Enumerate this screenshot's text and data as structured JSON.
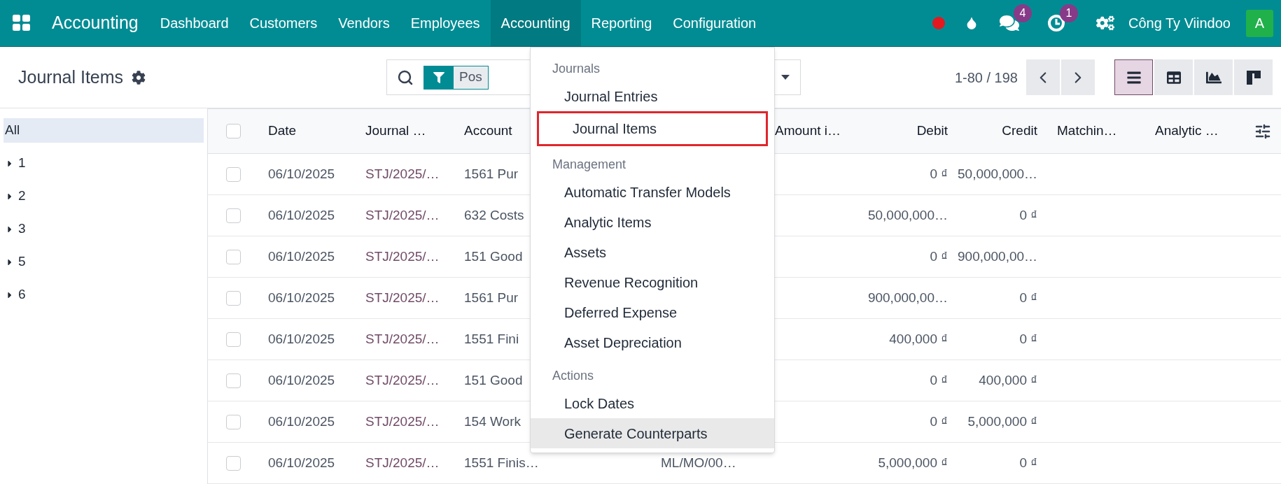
{
  "navbar": {
    "brand": "Accounting",
    "menus": [
      {
        "label": "Dashboard",
        "selected": false
      },
      {
        "label": "Customers",
        "selected": false
      },
      {
        "label": "Vendors",
        "selected": false
      },
      {
        "label": "Employees",
        "selected": false
      },
      {
        "label": "Accounting",
        "selected": true
      },
      {
        "label": "Reporting",
        "selected": false
      },
      {
        "label": "Configuration",
        "selected": false
      }
    ],
    "messages_badge": "4",
    "activities_badge": "1",
    "company": "Công Ty Viindoo",
    "avatar": "A"
  },
  "control_panel": {
    "title": "Journal Items",
    "search_facet": "Pos",
    "pager": "1-80 / 198",
    "views": [
      {
        "kind": "list",
        "selected": true
      },
      {
        "kind": "pivot",
        "selected": false
      },
      {
        "kind": "graph",
        "selected": false
      },
      {
        "kind": "kanban",
        "selected": false
      }
    ]
  },
  "sidebar": {
    "items": [
      {
        "label": "All",
        "kind": "all",
        "selected": true
      },
      {
        "label": "1",
        "kind": "group",
        "selected": false
      },
      {
        "label": "2",
        "kind": "group",
        "selected": false
      },
      {
        "label": "3",
        "kind": "group",
        "selected": false
      },
      {
        "label": "5",
        "kind": "group",
        "selected": false
      },
      {
        "label": "6",
        "kind": "group",
        "selected": false
      }
    ]
  },
  "table": {
    "columns": [
      {
        "label": "Date"
      },
      {
        "label": "Journal …"
      },
      {
        "label": "Account"
      },
      {
        "label": "Amount i…"
      },
      {
        "label": "Debit"
      },
      {
        "label": "Credit"
      },
      {
        "label": "Matchin…"
      },
      {
        "label": "Analytic …"
      }
    ],
    "header_checked": false,
    "rows": [
      {
        "checked": false,
        "date": "06/10/2025",
        "journal": "STJ/2025/…",
        "account": "1561 Pur",
        "debit": "0 ₫",
        "credit": "50,000,000…"
      },
      {
        "checked": false,
        "date": "06/10/2025",
        "journal": "STJ/2025/…",
        "account": "632 Costs",
        "debit": "50,000,000…",
        "credit": "0 ₫"
      },
      {
        "checked": false,
        "date": "06/10/2025",
        "journal": "STJ/2025/…",
        "account": "151 Good",
        "debit": "0 ₫",
        "credit": "900,000,00…"
      },
      {
        "checked": false,
        "date": "06/10/2025",
        "journal": "STJ/2025/…",
        "account": "1561 Pur",
        "debit": "900,000,00…",
        "credit": "0 ₫"
      },
      {
        "checked": false,
        "date": "06/10/2025",
        "journal": "STJ/2025/…",
        "account": "1551 Fini",
        "debit": "400,000 ₫",
        "credit": "0 ₫"
      },
      {
        "checked": false,
        "date": "06/10/2025",
        "journal": "STJ/2025/…",
        "account": "151 Good",
        "debit": "0 ₫",
        "credit": "400,000 ₫"
      },
      {
        "checked": false,
        "date": "06/10/2025",
        "journal": "STJ/2025/…",
        "account": "154 Work",
        "debit": "0 ₫",
        "credit": "5,000,000 ₫"
      },
      {
        "checked": false,
        "date": "06/10/2025",
        "journal": "STJ/2025/…",
        "account": "1551 Finis…",
        "column_5": "ML/MO/00…",
        "debit": "5,000,000 ₫",
        "credit": "0 ₫"
      }
    ]
  },
  "dropdown_menu": {
    "sections": [
      {
        "heading": "Journals",
        "items": [
          {
            "label": "Journal Entries",
            "highlighted": false,
            "outlined": false
          },
          {
            "label": "Journal Items",
            "highlighted": false,
            "outlined": true
          }
        ]
      },
      {
        "heading": "Management",
        "items": [
          {
            "label": "Automatic Transfer Models",
            "highlighted": false,
            "outlined": false
          },
          {
            "label": "Analytic Items",
            "highlighted": false,
            "outlined": false
          },
          {
            "label": "Assets",
            "highlighted": false,
            "outlined": false
          },
          {
            "label": "Revenue Recognition",
            "highlighted": false,
            "outlined": false
          },
          {
            "label": "Deferred Expense",
            "highlighted": false,
            "outlined": false
          },
          {
            "label": "Asset Depreciation",
            "highlighted": false,
            "outlined": false
          }
        ]
      },
      {
        "heading": "Actions",
        "items": [
          {
            "label": "Lock Dates",
            "highlighted": false,
            "outlined": false
          },
          {
            "label": "Generate Counterparts",
            "highlighted": true,
            "outlined": false
          }
        ]
      }
    ]
  }
}
